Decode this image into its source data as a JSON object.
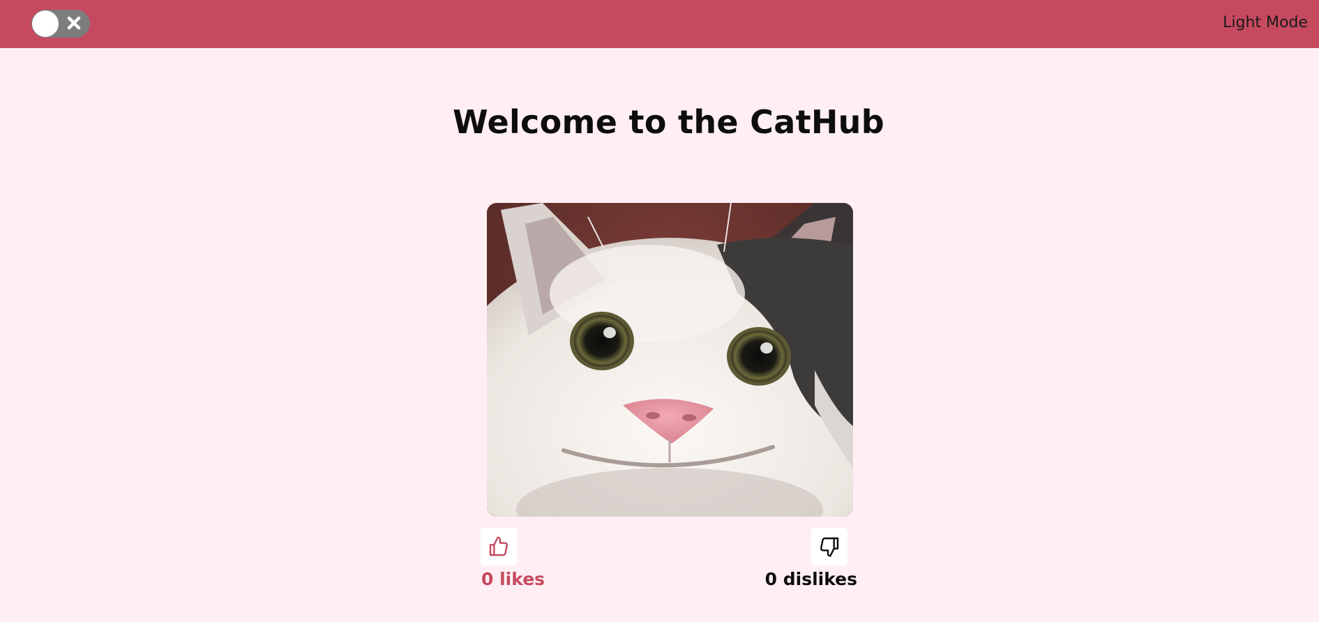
{
  "header": {
    "mode_label": "Light Mode",
    "toggle_state": "off",
    "toggle_icon": "close-icon"
  },
  "main": {
    "title": "Welcome to the CatHub",
    "image_subject": "cat-photo"
  },
  "votes": {
    "like_icon": "thumbs-up-icon",
    "dislike_icon": "thumbs-down-icon",
    "likes_label": "0 likes",
    "dislikes_label": "0 dislikes"
  },
  "colors": {
    "accent": "#c64a5f",
    "background": "#ffeff4",
    "toggle_track": "#7d7d7d"
  }
}
